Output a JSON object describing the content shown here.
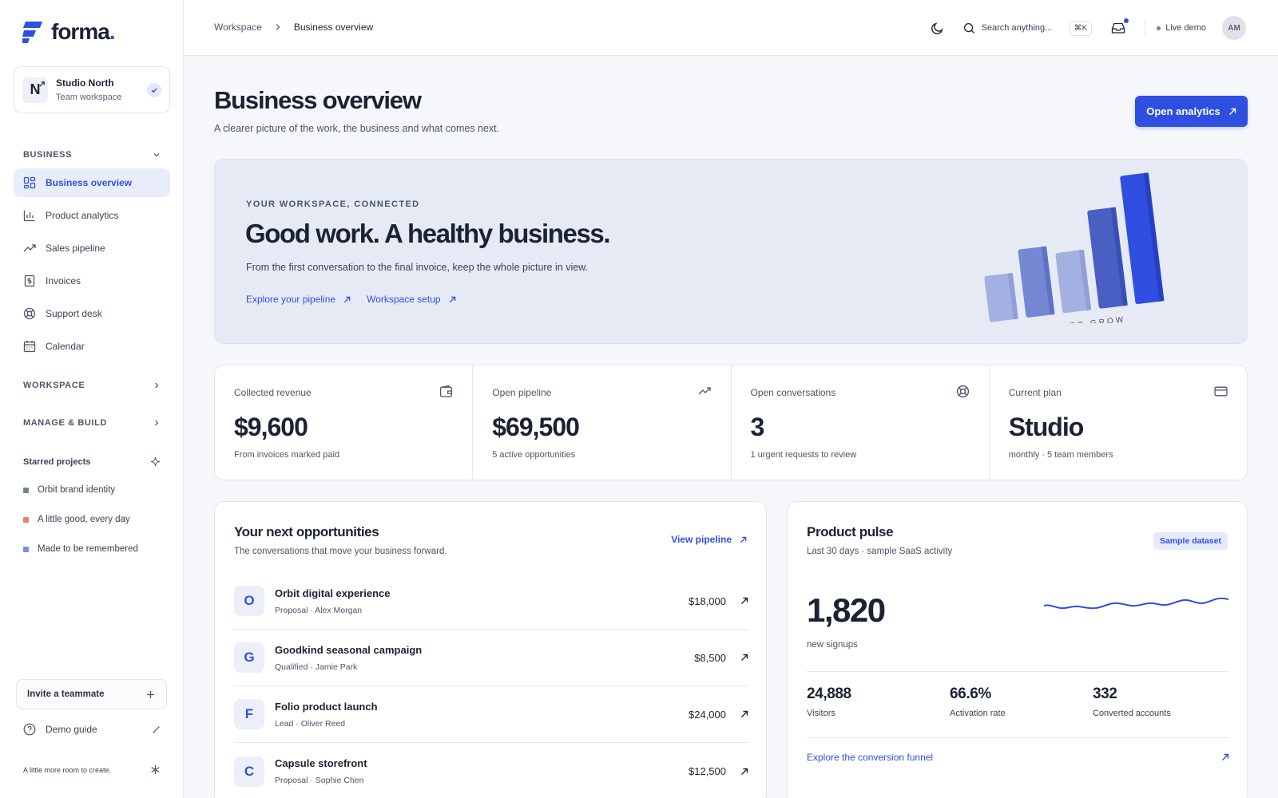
{
  "app": {
    "brand": "forma",
    "brand_dot": "."
  },
  "workspace": {
    "initial": "N",
    "name": "Studio North",
    "sub": "Team workspace"
  },
  "sidebar": {
    "business_label": "BUSINESS",
    "items": [
      {
        "label": "Business overview",
        "icon": "grid-icon",
        "active": true
      },
      {
        "label": "Product analytics",
        "icon": "bar-chart-icon"
      },
      {
        "label": "Sales pipeline",
        "icon": "trending-up-icon"
      },
      {
        "label": "Invoices",
        "icon": "invoice-icon"
      },
      {
        "label": "Support desk",
        "icon": "lifebuoy-icon"
      },
      {
        "label": "Calendar",
        "icon": "calendar-icon"
      }
    ],
    "workspace_label": "WORKSPACE",
    "manage_label": "MANAGE & BUILD",
    "starred_label": "Starred projects",
    "starred": [
      {
        "label": "Orbit brand identity",
        "color": "#6f8d74"
      },
      {
        "label": "A little good, every day",
        "color": "#e0876a"
      },
      {
        "label": "Made to be remembered",
        "color": "#7b8fe8"
      }
    ],
    "invite_label": "Invite a teammate",
    "demo_guide_label": "Demo guide",
    "footer_note": "A little more room to create."
  },
  "topbar": {
    "breadcrumb_root": "Workspace",
    "breadcrumb_current": "Business overview",
    "search_placeholder": "Search anything...",
    "shortcut": "⌘K",
    "live_label": "Live demo",
    "avatar_initials": "AM"
  },
  "page": {
    "title": "Business overview",
    "subtitle": "A clearer picture of the work, the business and what comes next.",
    "primary_button": "Open analytics"
  },
  "hero": {
    "eyebrow": "YOUR WORKSPACE, CONNECTED",
    "title": "Good work. A healthy business.",
    "subtitle": "From the first conversation to the final invoice, keep the whole picture in view.",
    "link1": "Explore your pipeline",
    "link2": "Workspace setup",
    "art_caption": "ROOM TO GROW"
  },
  "stats": [
    {
      "label": "Collected revenue",
      "value": "$9,600",
      "note": "From invoices marked paid",
      "icon": "wallet-icon"
    },
    {
      "label": "Open pipeline",
      "value": "$69,500",
      "note": "5 active opportunities",
      "icon": "trending-up-icon"
    },
    {
      "label": "Open conversations",
      "value": "3",
      "note": "1 urgent requests to review",
      "icon": "lifebuoy-icon"
    },
    {
      "label": "Current plan",
      "value": "Studio",
      "note": "monthly · 5 team members",
      "icon": "credit-card-icon"
    }
  ],
  "opportunities": {
    "title": "Your next opportunities",
    "subtitle": "The conversations that move your business forward.",
    "view_link": "View pipeline",
    "rows": [
      {
        "initial": "O",
        "name": "Orbit digital experience",
        "meta": "Proposal · Alex Morgan",
        "amount": "$18,000"
      },
      {
        "initial": "G",
        "name": "Goodkind seasonal campaign",
        "meta": "Qualified · Jamie Park",
        "amount": "$8,500"
      },
      {
        "initial": "F",
        "name": "Folio product launch",
        "meta": "Lead · Oliver Reed",
        "amount": "$24,000"
      },
      {
        "initial": "C",
        "name": "Capsule storefront",
        "meta": "Proposal · Sophie Chen",
        "amount": "$12,500"
      }
    ]
  },
  "pulse": {
    "title": "Product pulse",
    "subtitle": "Last 30 days · sample SaaS activity",
    "badge": "Sample dataset",
    "big_value": "1,820",
    "big_label": "new signups",
    "metrics": [
      {
        "value": "24,888",
        "label": "Visitors"
      },
      {
        "value": "66.6%",
        "label": "Activation rate"
      },
      {
        "value": "332",
        "label": "Converted accounts"
      }
    ],
    "funnel_link": "Explore the conversion funnel"
  },
  "colors": {
    "accent": "#2f4fe0",
    "hero_bg": "#e6eaf5"
  }
}
